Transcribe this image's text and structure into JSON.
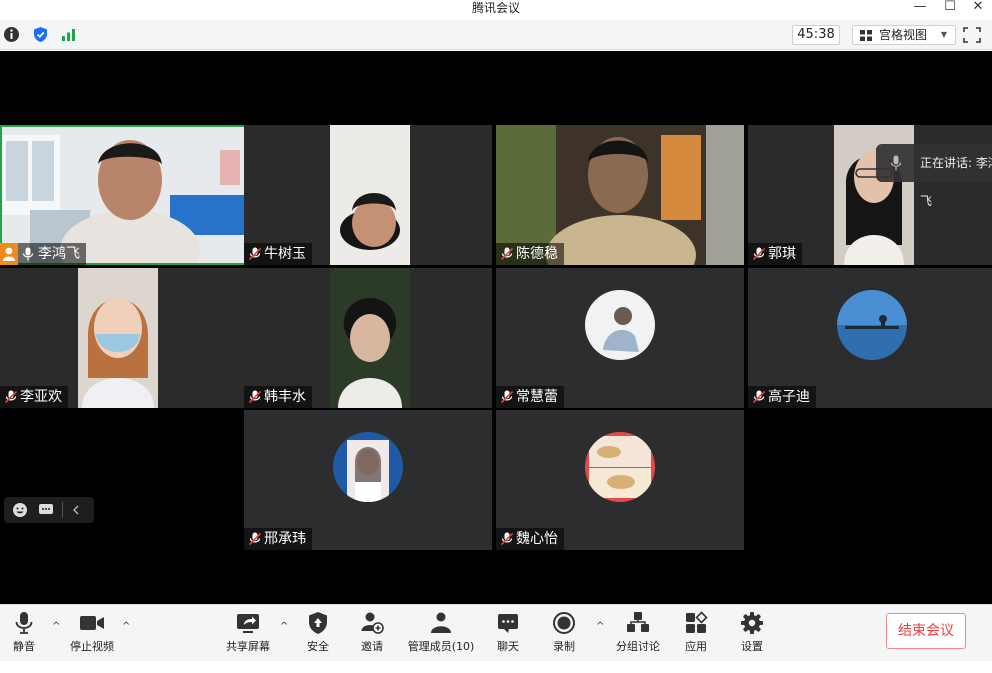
{
  "window": {
    "title": "腾讯会议",
    "minimize": "—",
    "maximize": "☐",
    "close": "✕"
  },
  "topbar": {
    "timer": "45:38",
    "view_mode": "宫格视图",
    "view_caret": "▼",
    "signal_color": "#1fa64a"
  },
  "speaking": {
    "text": "正在讲话: 李鸿飞"
  },
  "participants": [
    {
      "name": "李鸿飞",
      "host": true,
      "muted": false
    },
    {
      "name": "牛树玉",
      "muted": true
    },
    {
      "name": "陈德稳",
      "muted": true
    },
    {
      "name": "郭琪",
      "muted": true
    },
    {
      "name": "李亚欢",
      "muted": true
    },
    {
      "name": "韩丰水",
      "muted": true
    },
    {
      "name": "常慧蕾",
      "muted": true
    },
    {
      "name": "高子迪",
      "muted": true
    },
    {
      "name": "邢承玮",
      "muted": true
    },
    {
      "name": "魏心怡",
      "muted": true
    }
  ],
  "toolbar": {
    "mute": "静音",
    "stop_video": "停止视频",
    "share_screen": "共享屏幕",
    "security": "安全",
    "invite": "邀请",
    "manage_members": "管理成员(10)",
    "chat": "聊天",
    "record": "录制",
    "breakout": "分组讨论",
    "apps": "应用",
    "settings": "设置",
    "end_meeting": "结束会议",
    "caret": "^"
  },
  "colors": {
    "accent_blue": "#1b6ff5",
    "end_red": "#e8413d",
    "active_green": "#1fa64a",
    "host_orange": "#f08a1c"
  }
}
